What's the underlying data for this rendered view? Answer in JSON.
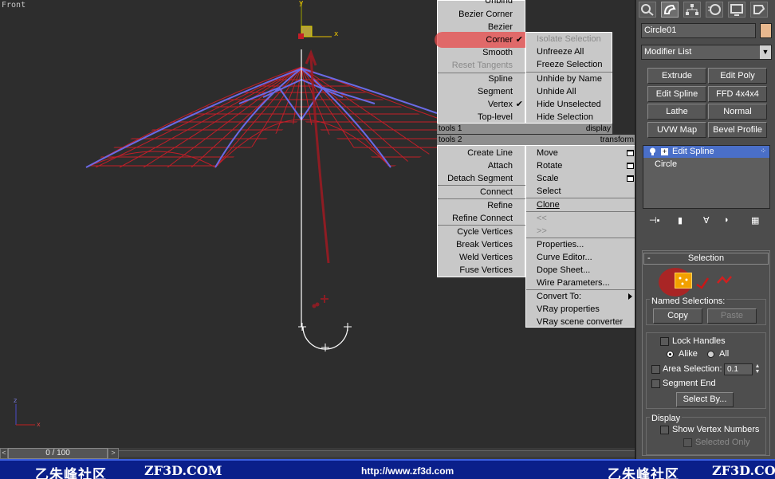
{
  "viewport": {
    "label": "Front",
    "axis_x": "x",
    "axis_y": "y",
    "axis_z": "z",
    "colors": {
      "wire_red": "#c31e28",
      "wire_blue": "#6a6ae6",
      "background": "#2d2d2d"
    }
  },
  "timeline": {
    "frame": "0 / 100",
    "prev": "<",
    "next": ">"
  },
  "banner": {
    "logo_left": "乙朱峰社区",
    "site_left": "ZF3D.COM",
    "url": "http://www.zf3d.com",
    "logo_right": "乙朱峰社区",
    "site_right": "ZF3D.COM",
    "color": "#0a1f8a"
  },
  "quad_menu": {
    "tools1_header": "tools 1",
    "display_header": "display",
    "tools2_header": "tools 2",
    "transform_header": "transform",
    "tools1": [
      {
        "label": "Unbind",
        "state": "normal"
      },
      {
        "label": "Bezier Corner",
        "state": "normal"
      },
      {
        "label": "Bezier",
        "state": "normal"
      },
      {
        "label": "Corner",
        "state": "checked"
      },
      {
        "label": "Smooth",
        "state": "normal"
      },
      {
        "label": "Reset Tangents",
        "state": "disabled"
      },
      {
        "label": "Spline",
        "state": "normal"
      },
      {
        "label": "Segment",
        "state": "normal"
      },
      {
        "label": "Vertex",
        "state": "checked"
      },
      {
        "label": "Top-level",
        "state": "normal"
      }
    ],
    "display": [
      {
        "label": "Isolate Selection",
        "state": "disabled"
      },
      {
        "label": "Unfreeze All",
        "state": "normal"
      },
      {
        "label": "Freeze Selection",
        "state": "normal"
      },
      {
        "label": "Unhide by Name",
        "state": "normal"
      },
      {
        "label": "Unhide All",
        "state": "normal"
      },
      {
        "label": "Hide Unselected",
        "state": "normal"
      },
      {
        "label": "Hide Selection",
        "state": "normal"
      }
    ],
    "tools2": [
      "Create Line",
      "Attach",
      "Detach Segment",
      "Connect",
      "Refine",
      "Refine Connect",
      "Cycle Vertices",
      "Break Vertices",
      "Weld Vertices",
      "Fuse Vertices"
    ],
    "transform": [
      {
        "label": "Move",
        "state": "normal"
      },
      {
        "label": "Rotate",
        "state": "normal"
      },
      {
        "label": "Scale",
        "state": "normal"
      },
      {
        "label": "Select",
        "state": "normal"
      },
      {
        "label": "Clone",
        "state": "normal"
      },
      {
        "label": "<<",
        "state": "disabled"
      },
      {
        "label": ">>",
        "state": "disabled"
      },
      {
        "label": "Properties...",
        "state": "normal"
      },
      {
        "label": "Curve Editor...",
        "state": "normal"
      },
      {
        "label": "Dope Sheet...",
        "state": "normal"
      },
      {
        "label": "Wire Parameters...",
        "state": "normal"
      },
      {
        "label": "Convert To:",
        "state": "normal"
      },
      {
        "label": "VRay properties",
        "state": "normal"
      },
      {
        "label": "VRay scene converter",
        "state": "normal"
      }
    ]
  },
  "command_panel": {
    "tabs": [
      "create-tab-icon",
      "modify-tab-icon",
      "hierarchy-tab-icon",
      "motion-tab-icon",
      "display-tab-icon",
      "utilities-tab-icon"
    ],
    "object_name": "Circle01",
    "object_color": "#e8b88e",
    "modifier_list": "Modifier List",
    "modifier_buttons": [
      "Extrude",
      "Edit Poly",
      "Edit Spline",
      "FFD 4x4x4",
      "Lathe",
      "Normal",
      "UVW Map",
      "Bevel Profile"
    ],
    "stack": [
      {
        "label": "Edit Spline",
        "selected": true
      },
      {
        "label": "Circle",
        "selected": false
      }
    ],
    "selection": {
      "title": "Selection",
      "collapse": "-",
      "named_selections": "Named Selections:",
      "copy": "Copy",
      "paste": "Paste",
      "lock_handles": "Lock Handles",
      "alike": "Alike",
      "all": "All",
      "area_selection": "Area Selection:",
      "area_value": "0.1",
      "segment_end": "Segment End",
      "select_by": "Select By...",
      "display": "Display",
      "show_vertex_numbers": "Show Vertex Numbers",
      "selected_only": "Selected Only"
    }
  }
}
